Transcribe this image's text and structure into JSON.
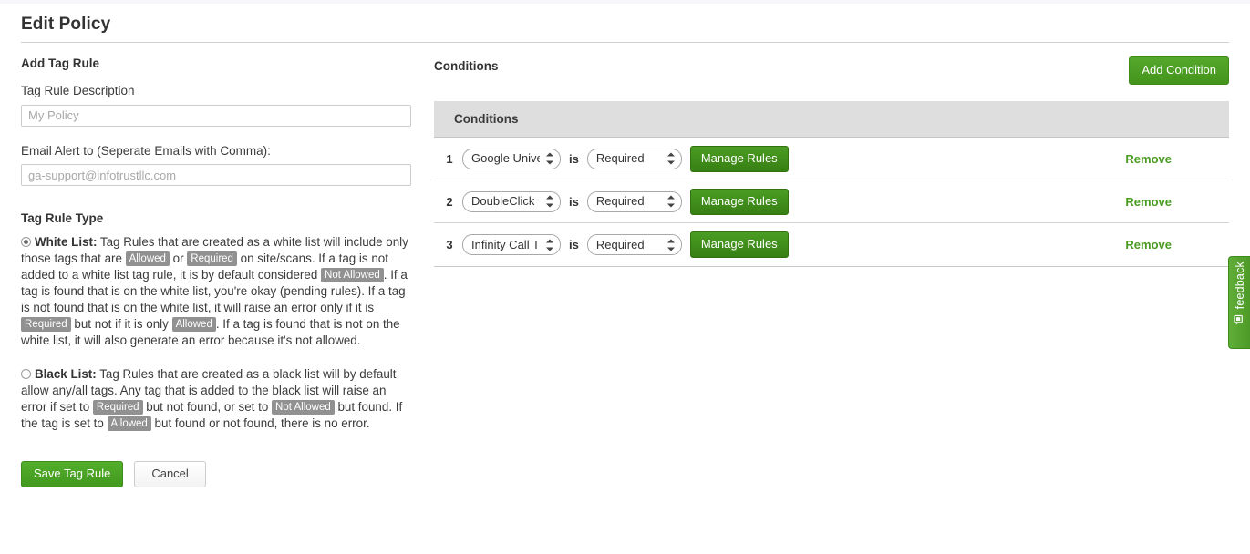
{
  "page": {
    "title": "Edit Policy"
  },
  "left": {
    "section_heading": "Add Tag Rule",
    "description_label": "Tag Rule Description",
    "description_value": "",
    "description_placeholder": "My Policy",
    "email_label": "Email Alert to (Seperate Emails with Comma):",
    "email_value": "",
    "email_placeholder": "ga-support@infotrustllc.com",
    "tag_rule_type_heading": "Tag Rule Type",
    "white_list": {
      "name": "White List:",
      "selected": true,
      "part1": " Tag Rules that are created as a white list will include only those tags that are ",
      "badge1": "Allowed",
      "part2": " or ",
      "badge2": "Required",
      "part3": " on site/scans. If a tag is not added to a white list tag rule, it is by default considered ",
      "badge3": "Not Allowed",
      "part4": ". If a tag is found that is on the white list, you're okay (pending rules). If a tag is not found that is on the white list, it will raise an error only if it is ",
      "badge4": "Required",
      "part5": " but not if it is only ",
      "badge5": "Allowed",
      "part6": ". If a tag is found that is not on the white list, it will also generate an error because it's not allowed."
    },
    "black_list": {
      "name": "Black List:",
      "selected": false,
      "part1": " Tag Rules that are created as a black list will by default allow any/all tags. Any tag that is added to the black list will raise an error if set to ",
      "badge1": "Required",
      "part2": " but not found, or set to ",
      "badge2": "Not Allowed",
      "part3": " but found. If the tag is set to ",
      "badge3": "Allowed",
      "part4": " but found or not found, there is no error."
    },
    "save_button": "Save Tag Rule",
    "cancel_button": "Cancel"
  },
  "right": {
    "conditions_title": "Conditions",
    "add_condition_button": "Add Condition",
    "table_header": "Conditions",
    "is_word": "is",
    "manage_rules_button": "Manage Rules",
    "remove_link": "Remove",
    "rows": [
      {
        "num": "1",
        "tag": "Google Univers",
        "state": "Required"
      },
      {
        "num": "2",
        "tag": "DoubleClick",
        "state": "Required"
      },
      {
        "num": "3",
        "tag": "Infinity Call Tra",
        "state": "Required"
      }
    ]
  },
  "feedback": {
    "label": "feedback",
    "icon": "comment-icon"
  },
  "colors": {
    "accent_green": "#4a9b21",
    "button_green": "#3d8f18",
    "badge_gray": "#919191",
    "header_gray": "#dedede"
  }
}
